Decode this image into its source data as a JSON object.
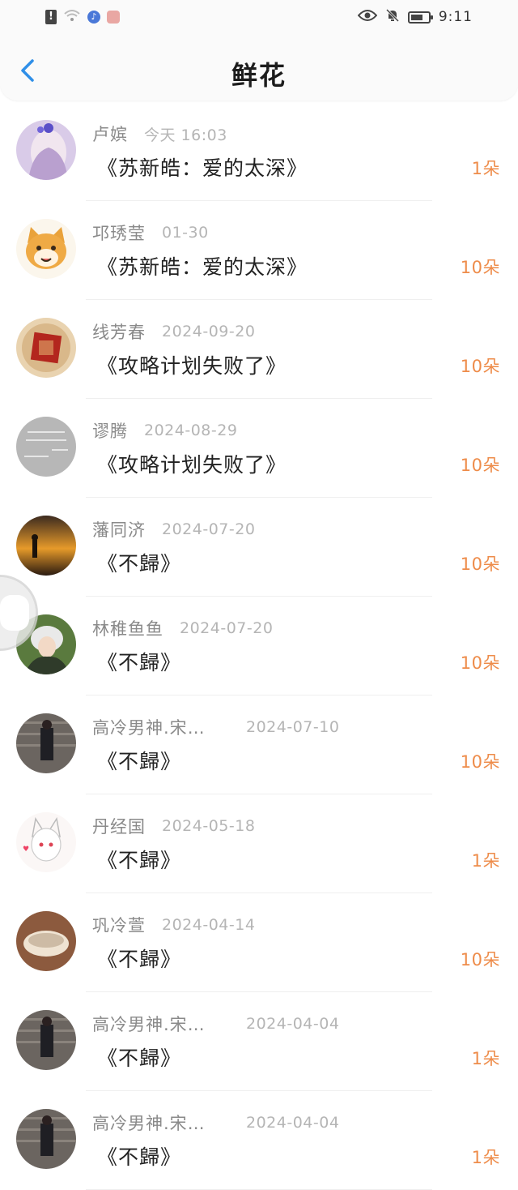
{
  "status_bar": {
    "time": "9:11",
    "icons": [
      "alert-icon",
      "wifi-icon",
      "music-app-icon",
      "app-icon",
      "eye-icon",
      "bell-muted-icon",
      "battery-icon"
    ]
  },
  "header": {
    "title": "鲜花",
    "back_icon": "chevron-left-icon",
    "accent_color": "#2f8fe8"
  },
  "colors": {
    "count_color": "#ee8c4a",
    "name_color": "#8a8a8a",
    "date_color": "#b5b5b5"
  },
  "items": [
    {
      "name": "卢嫔",
      "date": "今天 16:03",
      "book": "《苏新皓：爱的太深》",
      "count": "1朵"
    },
    {
      "name": "邛琇莹",
      "date": "01-30",
      "book": "《苏新皓：爱的太深》",
      "count": "10朵"
    },
    {
      "name": "线芳春",
      "date": "2024-09-20",
      "book": "《攻略计划失败了》",
      "count": "10朵"
    },
    {
      "name": "谬腾",
      "date": "2024-08-29",
      "book": "《攻略计划失败了》",
      "count": "10朵"
    },
    {
      "name": "藩同济",
      "date": "2024-07-20",
      "book": "《不歸》",
      "count": "10朵"
    },
    {
      "name": "林稚鱼鱼",
      "date": "2024-07-20",
      "book": "《不歸》",
      "count": "10朵"
    },
    {
      "name": "高冷男神.宋…",
      "date": "2024-07-10",
      "book": "《不歸》",
      "count": "10朵"
    },
    {
      "name": "丹经国",
      "date": "2024-05-18",
      "book": "《不歸》",
      "count": "1朵"
    },
    {
      "name": "巩冷萱",
      "date": "2024-04-14",
      "book": "《不歸》",
      "count": "10朵"
    },
    {
      "name": "高冷男神.宋…",
      "date": "2024-04-04",
      "book": "《不歸》",
      "count": "1朵"
    },
    {
      "name": "高冷男神.宋…",
      "date": "2024-04-04",
      "book": "《不歸》",
      "count": "1朵"
    }
  ]
}
